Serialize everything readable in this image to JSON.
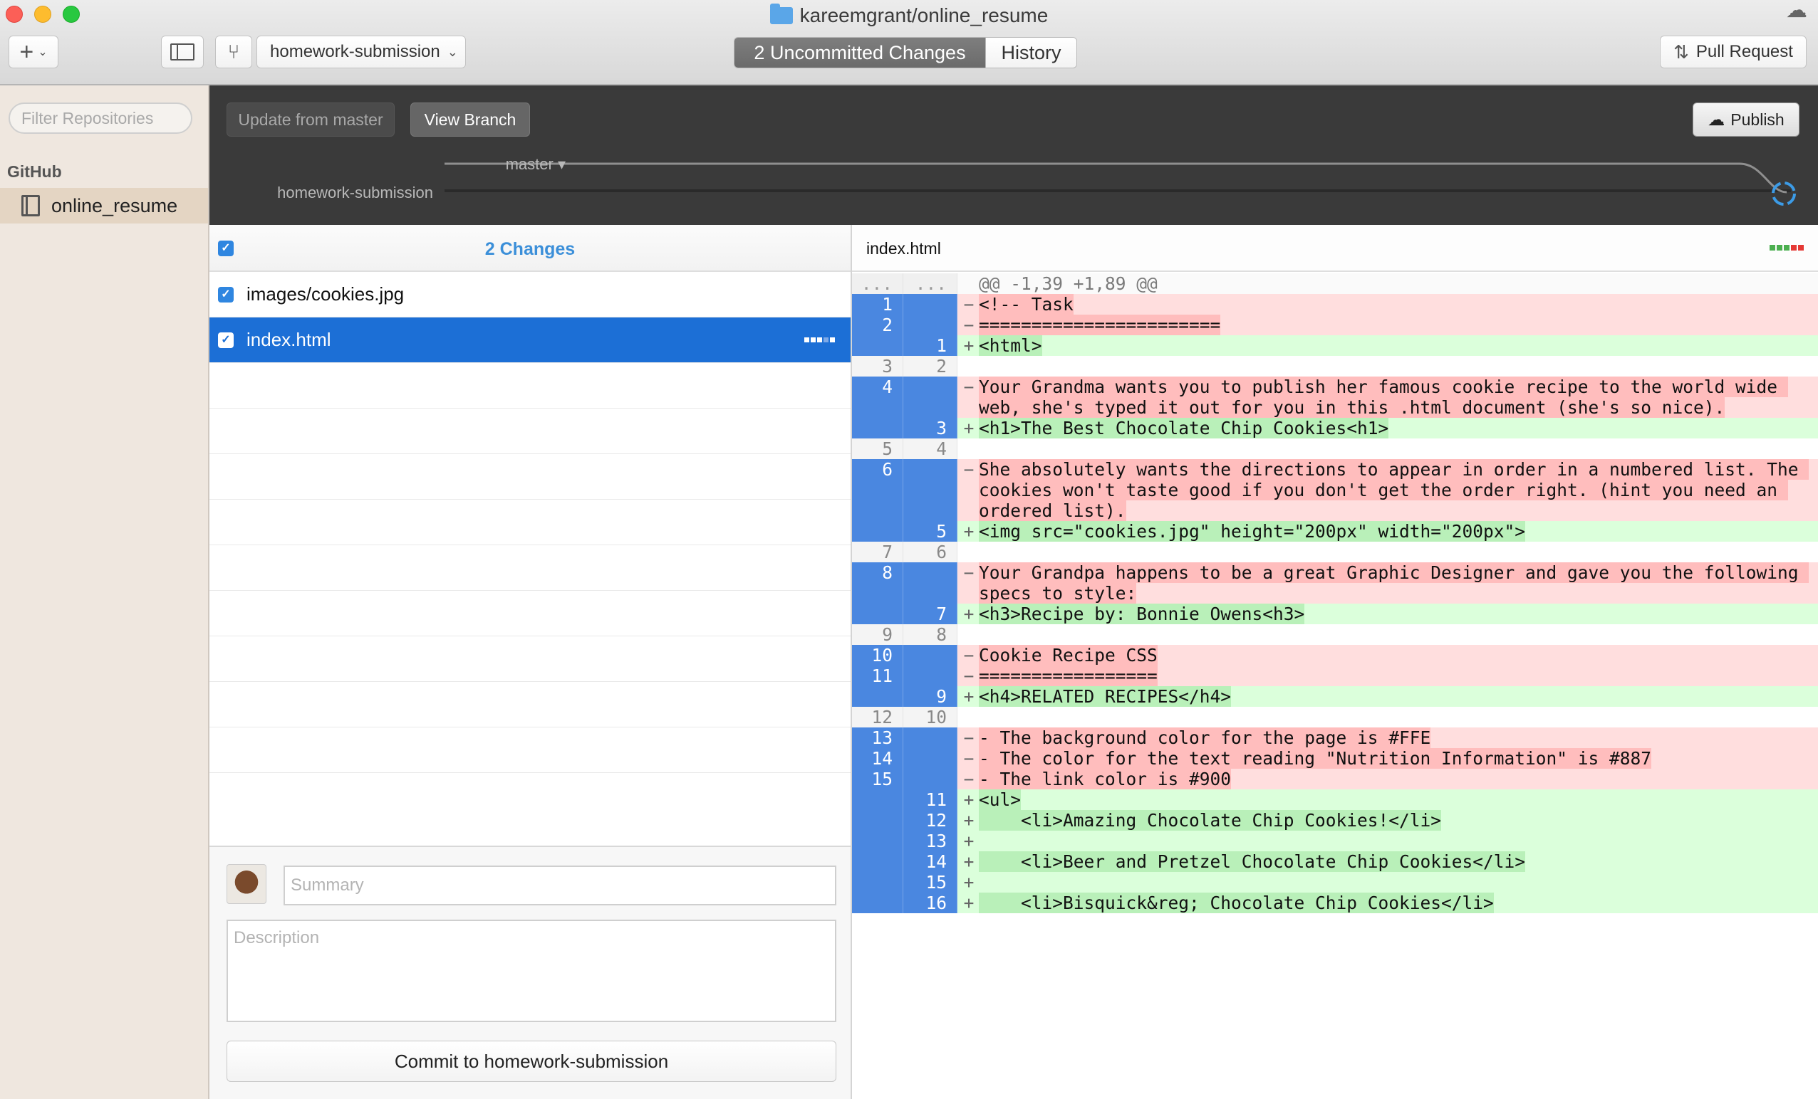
{
  "window": {
    "title": "kareemgrant/online_resume"
  },
  "toolbar": {
    "add_icon": "plus-icon",
    "branch_name": "homework-submission",
    "tabs": [
      {
        "label": "2 Uncommitted Changes",
        "active": true
      },
      {
        "label": "History",
        "active": false
      }
    ],
    "pull_request_label": "Pull Request"
  },
  "sidebar": {
    "filter_placeholder": "Filter Repositories",
    "heading": "GitHub",
    "repo": "online_resume"
  },
  "branch_bar": {
    "update_label": "Update from master",
    "view_branch_label": "View Branch",
    "publish_label": "Publish",
    "master_label": "master ▾",
    "feature_label": "homework-submission"
  },
  "changes": {
    "header": "2 Changes",
    "files": [
      {
        "name": "images/cookies.jpg",
        "selected": false
      },
      {
        "name": "index.html",
        "selected": true
      }
    ]
  },
  "commit": {
    "summary_placeholder": "Summary",
    "description_placeholder": "Description",
    "button_label": "Commit to homework-submission"
  },
  "diff": {
    "filename": "index.html",
    "hunk_header": "@@ -1,39 +1,89 @@",
    "lines": [
      {
        "type": "hunk",
        "old": "...",
        "new": "...",
        "marker": "",
        "text": "@@ -1,39 +1,89 @@"
      },
      {
        "type": "del",
        "old": "1",
        "new": "",
        "marker": "−",
        "text": "<!-- Task"
      },
      {
        "type": "del",
        "old": "2",
        "new": "",
        "marker": "−",
        "text": "======================="
      },
      {
        "type": "add",
        "old": "",
        "new": "1",
        "marker": "+",
        "text": "<html>"
      },
      {
        "type": "ctx",
        "old": "3",
        "new": "2",
        "marker": "",
        "text": ""
      },
      {
        "type": "del",
        "old": "4",
        "new": "",
        "marker": "−",
        "text": "Your Grandma wants you to publish her famous cookie recipe to the world wide web, she's typed it out for you in this .html document (she's so nice)."
      },
      {
        "type": "add",
        "old": "",
        "new": "3",
        "marker": "+",
        "text": "<h1>The Best Chocolate Chip Cookies<h1>"
      },
      {
        "type": "ctx",
        "old": "5",
        "new": "4",
        "marker": "",
        "text": ""
      },
      {
        "type": "del",
        "old": "6",
        "new": "",
        "marker": "−",
        "text": "She absolutely wants the directions to appear in order in a numbered list. The cookies won't taste good if you don't get the order right. (hint you need an ordered list)."
      },
      {
        "type": "add",
        "old": "",
        "new": "5",
        "marker": "+",
        "text": "<img src=\"cookies.jpg\" height=\"200px\" width=\"200px\">"
      },
      {
        "type": "ctx",
        "old": "7",
        "new": "6",
        "marker": "",
        "text": ""
      },
      {
        "type": "del",
        "old": "8",
        "new": "",
        "marker": "−",
        "text": "Your Grandpa happens to be a great Graphic Designer and gave you the following specs to style:"
      },
      {
        "type": "add",
        "old": "",
        "new": "7",
        "marker": "+",
        "text": "<h3>Recipe by: Bonnie Owens<h3>"
      },
      {
        "type": "ctx",
        "old": "9",
        "new": "8",
        "marker": "",
        "text": ""
      },
      {
        "type": "del",
        "old": "10",
        "new": "",
        "marker": "−",
        "text": "Cookie Recipe CSS"
      },
      {
        "type": "del",
        "old": "11",
        "new": "",
        "marker": "−",
        "text": "================="
      },
      {
        "type": "add",
        "old": "",
        "new": "9",
        "marker": "+",
        "text": "<h4>RELATED RECIPES</h4>"
      },
      {
        "type": "ctx",
        "old": "12",
        "new": "10",
        "marker": "",
        "text": ""
      },
      {
        "type": "del",
        "old": "13",
        "new": "",
        "marker": "−",
        "text": "- The background color for the page is #FFE"
      },
      {
        "type": "del",
        "old": "14",
        "new": "",
        "marker": "−",
        "text": "- The color for the text reading \"Nutrition Information\" is #887"
      },
      {
        "type": "del",
        "old": "15",
        "new": "",
        "marker": "−",
        "text": "- The link color is #900"
      },
      {
        "type": "add",
        "old": "",
        "new": "11",
        "marker": "+",
        "text": "<ul>"
      },
      {
        "type": "add",
        "old": "",
        "new": "12",
        "marker": "+",
        "text": "    <li>Amazing Chocolate Chip Cookies!</li>"
      },
      {
        "type": "add",
        "old": "",
        "new": "13",
        "marker": "+",
        "text": ""
      },
      {
        "type": "add",
        "old": "",
        "new": "14",
        "marker": "+",
        "text": "    <li>Beer and Pretzel Chocolate Chip Cookies</li>"
      },
      {
        "type": "add",
        "old": "",
        "new": "15",
        "marker": "+",
        "text": ""
      },
      {
        "type": "add",
        "old": "",
        "new": "16",
        "marker": "+",
        "text": "    <li>Bisquick&reg; Chocolate Chip Cookies</li>"
      }
    ]
  },
  "colors": {
    "accent_blue": "#1c6fd6",
    "diff_gutter": "#4a87e0",
    "deletion_bg": "#ffdede",
    "addition_bg": "#dbffdb"
  }
}
